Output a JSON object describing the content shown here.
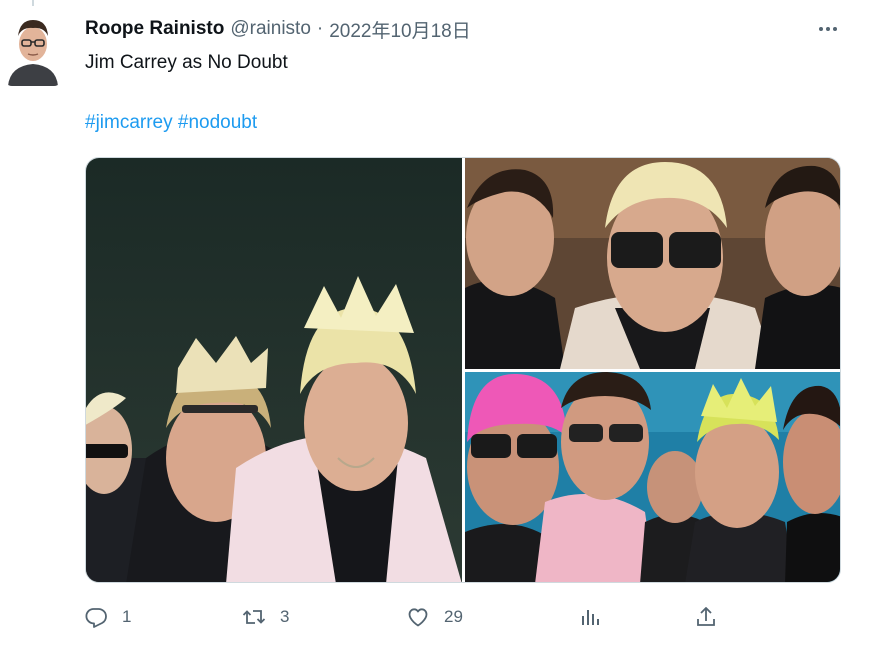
{
  "tweet": {
    "author_name": "Roope Rainisto",
    "author_handle": "@rainisto",
    "separator": "·",
    "timestamp": "2022年10月18日",
    "text": "Jim Carrey as No Doubt",
    "hashtags": [
      "#jimcarrey",
      "#nodoubt"
    ]
  },
  "media": {
    "photo_count": 3
  },
  "actions": {
    "reply_count": "1",
    "retweet_count": "3",
    "like_count": "29"
  },
  "icons": {
    "more": "more-icon",
    "reply": "reply-icon",
    "retweet": "retweet-icon",
    "like": "heart-icon",
    "views": "bar-chart-icon",
    "share": "share-icon"
  },
  "colors": {
    "link": "#1d9bf0",
    "secondary_text": "#536471",
    "primary_text": "#0f1419",
    "border": "#cfd9de"
  }
}
